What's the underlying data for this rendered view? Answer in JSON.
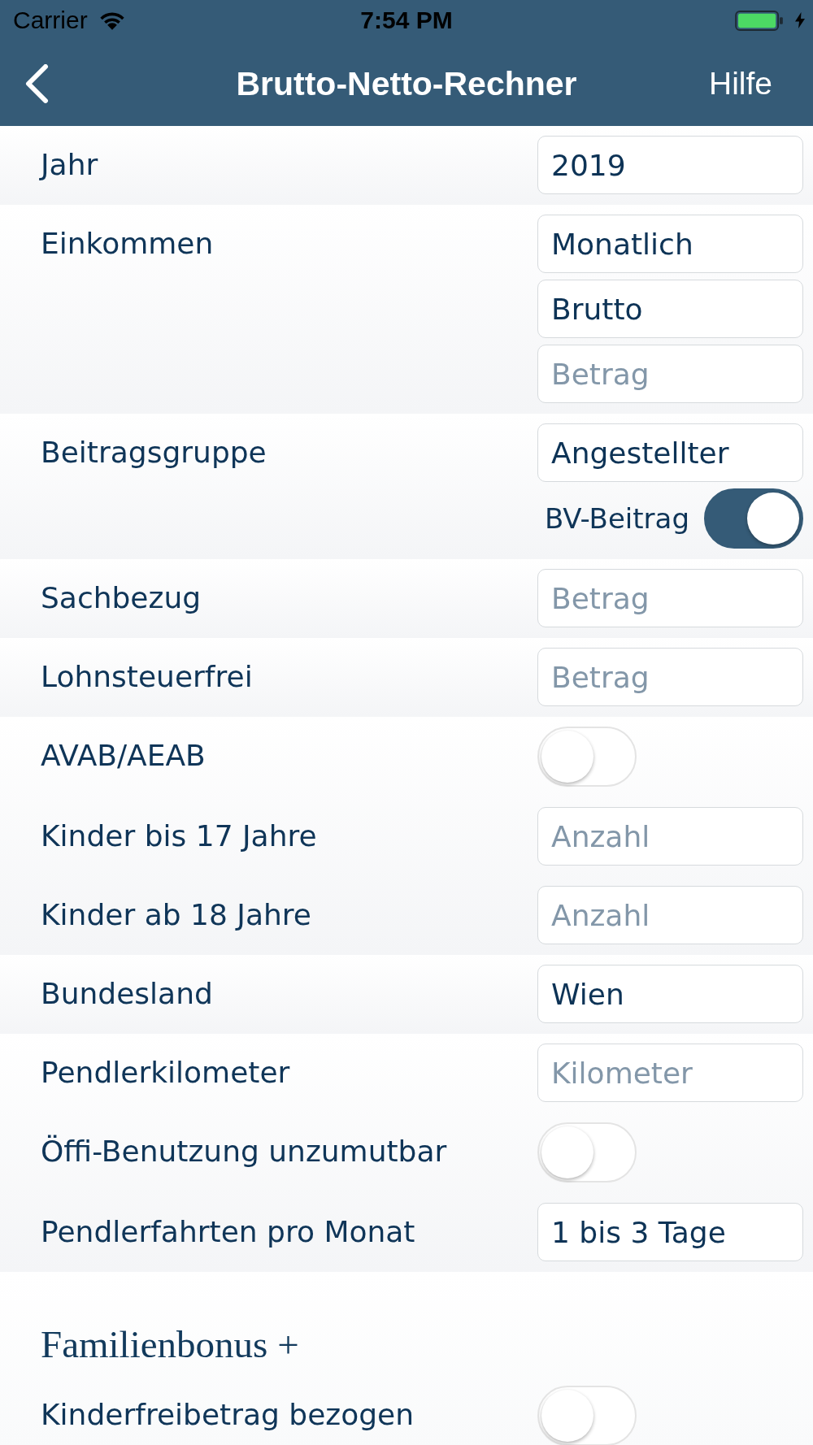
{
  "status_bar": {
    "carrier": "Carrier",
    "time": "7:54 PM"
  },
  "nav_bar": {
    "title": "Brutto-Netto-Rechner",
    "action": "Hilfe"
  },
  "sections": [
    {
      "rows": [
        {
          "label": "Jahr",
          "controls": [
            {
              "kind": "field",
              "value": "2019"
            }
          ]
        }
      ]
    },
    {
      "rows": [
        {
          "label": "Einkommen",
          "controls": [
            {
              "kind": "field",
              "value": "Monatlich"
            },
            {
              "kind": "field",
              "value": "Brutto"
            },
            {
              "kind": "field",
              "placeholder": "Betrag"
            }
          ]
        }
      ]
    },
    {
      "rows": [
        {
          "label": "Beitragsgruppe",
          "controls": [
            {
              "kind": "field",
              "value": "Angestellter"
            },
            {
              "kind": "switch",
              "label": "BV-Beitrag",
              "on": true
            }
          ]
        }
      ]
    },
    {
      "rows": [
        {
          "label": "Sachbezug",
          "controls": [
            {
              "kind": "field",
              "placeholder": "Betrag"
            }
          ]
        }
      ]
    },
    {
      "rows": [
        {
          "label": "Lohnsteuerfrei",
          "controls": [
            {
              "kind": "field",
              "placeholder": "Betrag"
            }
          ]
        }
      ]
    },
    {
      "rows": [
        {
          "label": "AVAB/AEAB",
          "controls": [
            {
              "kind": "switch",
              "on": false
            }
          ]
        },
        {
          "label": "Kinder bis 17 Jahre",
          "controls": [
            {
              "kind": "field",
              "placeholder": "Anzahl"
            }
          ]
        },
        {
          "label": "Kinder ab 18 Jahre",
          "controls": [
            {
              "kind": "field",
              "placeholder": "Anzahl"
            }
          ]
        }
      ]
    },
    {
      "rows": [
        {
          "label": "Bundesland",
          "controls": [
            {
              "kind": "field",
              "value": "Wien"
            }
          ]
        }
      ]
    },
    {
      "rows": [
        {
          "label": "Pendlerkilometer",
          "controls": [
            {
              "kind": "field",
              "placeholder": "Kilometer"
            }
          ]
        },
        {
          "label": "Öffi-Benutzung unzumutbar",
          "controls": [
            {
              "kind": "switch",
              "on": false
            }
          ]
        },
        {
          "label": "Pendlerfahrten pro Monat",
          "controls": [
            {
              "kind": "field",
              "value": "1 bis 3 Tage"
            }
          ]
        }
      ]
    },
    {
      "heading": "Familienbonus +",
      "rows": [
        {
          "label": "Kinderfreibetrag bezogen",
          "controls": [
            {
              "kind": "switch",
              "on": false
            }
          ]
        }
      ]
    }
  ]
}
